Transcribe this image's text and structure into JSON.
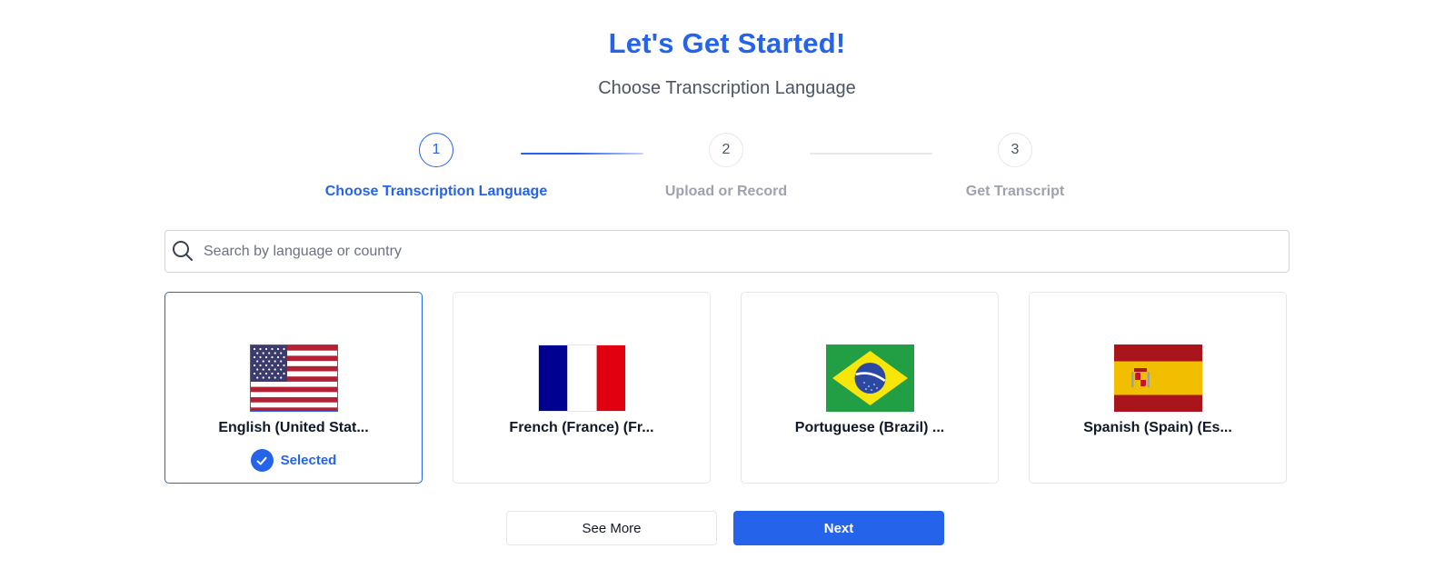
{
  "header": {
    "title": "Let's Get Started!",
    "subtitle": "Choose Transcription Language"
  },
  "stepper": {
    "steps": [
      {
        "number": "1",
        "label": "Choose Transcription Language",
        "state": "active"
      },
      {
        "number": "2",
        "label": "Upload or Record",
        "state": "inactive"
      },
      {
        "number": "3",
        "label": "Get Transcript",
        "state": "inactive"
      }
    ]
  },
  "search": {
    "placeholder": "Search by language or country",
    "value": "",
    "icon": "search-icon"
  },
  "languages": [
    {
      "label": "English (United Stat...",
      "flag": "us-flag-icon",
      "selected": true
    },
    {
      "label": "French (France) (Fr...",
      "flag": "france-flag-icon",
      "selected": false
    },
    {
      "label": "Portuguese (Brazil) ...",
      "flag": "brazil-flag-icon",
      "selected": false
    },
    {
      "label": "Spanish (Spain) (Es...",
      "flag": "spain-flag-icon",
      "selected": false
    }
  ],
  "selected_badge": {
    "text": "Selected",
    "icon": "check-circle-icon"
  },
  "actions": {
    "see_more_label": "See More",
    "next_label": "Next"
  },
  "colors": {
    "accent": "#2563eb",
    "muted_text": "#9ca3af",
    "border": "#e5e7eb"
  }
}
